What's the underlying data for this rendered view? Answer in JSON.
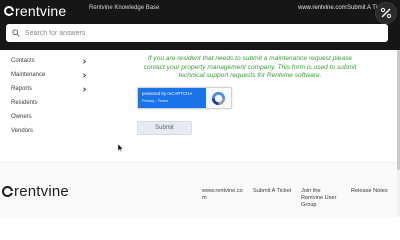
{
  "header": {
    "logo_text": "rentvine",
    "kb_title": "Rentvine Knowledge Base",
    "nav": [
      "www.rentvine.com",
      "Submit A Ticket"
    ]
  },
  "search": {
    "placeholder": "Search for answers"
  },
  "sidebar": {
    "items": [
      {
        "label": "Contacts",
        "has_submenu": true
      },
      {
        "label": "Maintenance",
        "has_submenu": true
      },
      {
        "label": "Reports",
        "has_submenu": true
      },
      {
        "label": "Residents",
        "has_submenu": false
      },
      {
        "label": "Owners",
        "has_submenu": false
      },
      {
        "label": "Vendors",
        "has_submenu": false
      }
    ]
  },
  "main": {
    "notice": "If you are resident that needs to submit a maintenance request please contact your property management company.  This form is used to submit technical support requests for Rentvine software.",
    "captcha": {
      "line1": "protected by reCAPTCHA",
      "line2": "Privacy - Terms"
    },
    "submit_label": "Submit"
  },
  "footer": {
    "logo_text": "rentvine",
    "links": [
      "www.rentvine.co m",
      "Submit A Ticket",
      "Join the Rentvine User Group",
      "Release Notes"
    ]
  },
  "colors": {
    "header_bg": "#161616",
    "notice_green": "#3d9b3a",
    "captcha_blue": "#1a73e8"
  }
}
